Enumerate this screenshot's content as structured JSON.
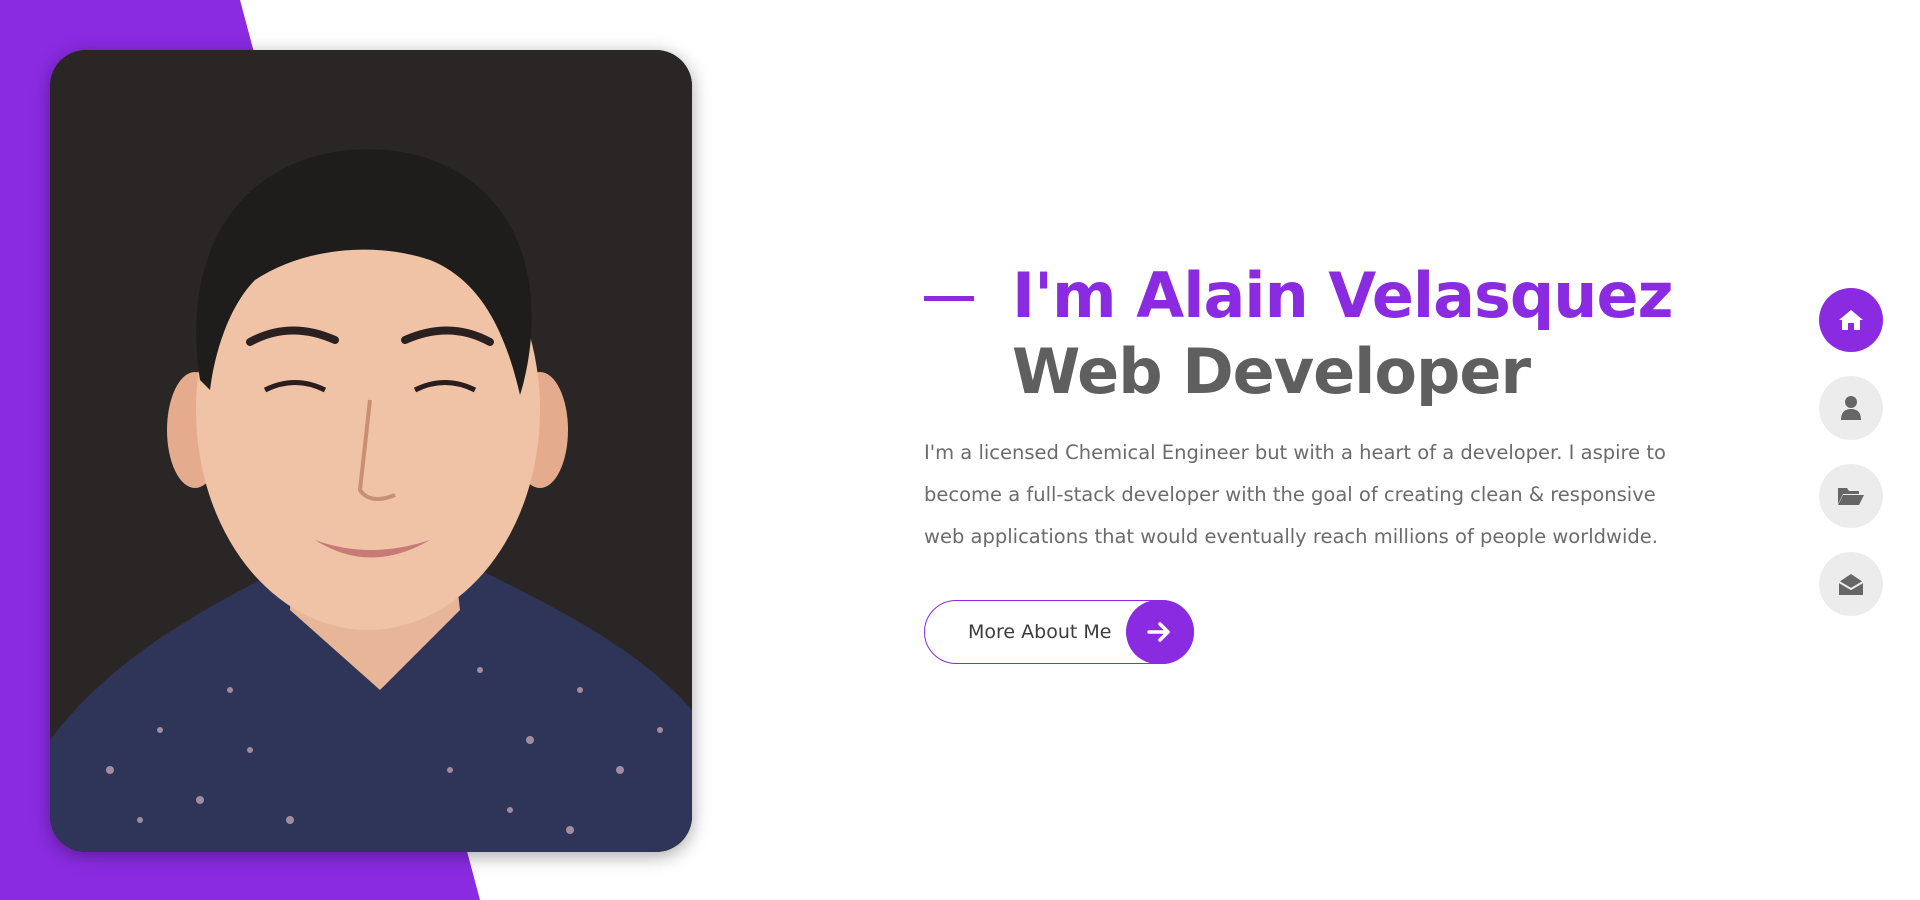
{
  "theme": {
    "accent": "#8a2be2",
    "muted_text": "#6b6b6b",
    "heading_gray": "#5f5f5f",
    "nav_bg": "#ececec",
    "nav_icon": "#666666"
  },
  "hero": {
    "photo_alt": "Portrait photo",
    "name": "I'm Alain Velasquez",
    "role": "Web Developer",
    "bio": "I'm a licensed Chemical Engineer but with a heart of a developer. I aspire to become a full-stack developer with the goal of creating clean & responsive web applications that would eventually reach millions of people worldwide.",
    "cta_label": "More About Me",
    "cta_icon": "arrow-right-icon"
  },
  "nav": {
    "items": [
      {
        "icon": "home-icon",
        "active": true
      },
      {
        "icon": "user-icon",
        "active": false
      },
      {
        "icon": "folder-open-icon",
        "active": false
      },
      {
        "icon": "envelope-open-icon",
        "active": false
      }
    ]
  }
}
